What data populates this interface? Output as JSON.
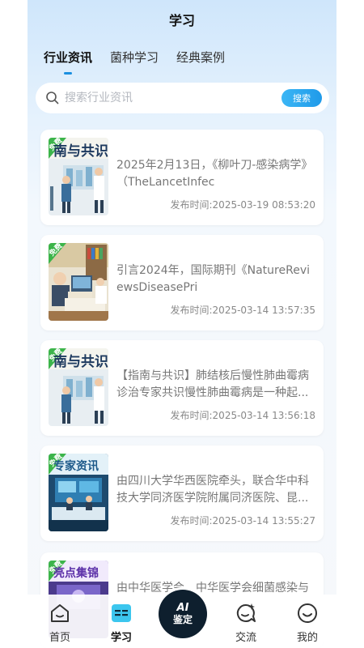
{
  "header": {
    "title": "学习"
  },
  "tabs": [
    {
      "label": "行业资讯"
    },
    {
      "label": "菌种学习"
    },
    {
      "label": "经典案例"
    }
  ],
  "search": {
    "placeholder": "搜索行业资讯",
    "button_label": "搜索"
  },
  "articles": [
    {
      "badge": "免费",
      "banner": "南与共识",
      "text": "2025年2月13日，《柳叶刀-感染病学》（TheLancetInfec",
      "date": "发布时间:2025-03-19 08:53:20"
    },
    {
      "badge": "免费",
      "banner": "",
      "text": "引言2024年，国际期刊《NatureReviewsDiseasePri",
      "date": "发布时间:2025-03-14 13:57:35"
    },
    {
      "badge": "免费",
      "banner": "南与共识",
      "text": "【指南与共识】肺结核后慢性肺曲霉病诊治专家共识慢性肺曲霉病是一种起...",
      "date": "发布时间:2025-03-14 13:56:18"
    },
    {
      "badge": "免费",
      "banner": "专家资讯",
      "text": "由四川大学华西医院牵头，联合华中科技大学同济医学院附属同济医院、昆...",
      "date": "发布时间:2025-03-14 13:55:27"
    },
    {
      "badge": "免费",
      "banner": "亮点集锦",
      "text": "由中华医学会、中华医学会细菌感染与",
      "date": ""
    }
  ],
  "tabbar": {
    "home": "首页",
    "study": "学习",
    "ai_line1": "AI",
    "ai_line2": "鉴定",
    "community": "交流",
    "mine": "我的"
  },
  "colors": {
    "accent": "#1a8fe0",
    "badge": "#3cb44a",
    "ai_button": "#0e1f2e"
  }
}
